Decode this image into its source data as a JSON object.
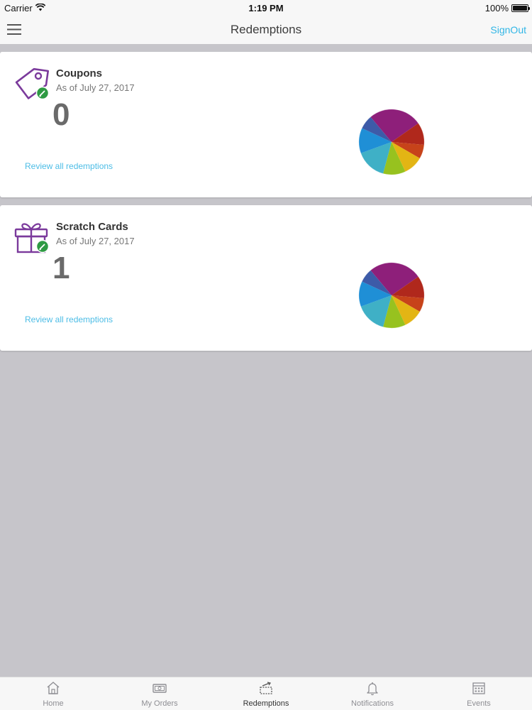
{
  "status_bar": {
    "carrier": "Carrier",
    "time": "1:19 PM",
    "battery": "100%",
    "battery_level": 1.0
  },
  "nav": {
    "title": "Redemptions",
    "signout_label": "SignOut"
  },
  "cards": [
    {
      "title": "Coupons",
      "date": "As of July 27, 2017",
      "count": "0",
      "link": "Review all redemptions",
      "icon": "tag-icon"
    },
    {
      "title": "Scratch Cards",
      "date": "As of July 27, 2017",
      "count": "1",
      "link": "Review all redemptions",
      "icon": "gift-icon"
    }
  ],
  "tabs": [
    {
      "label": "Home",
      "icon": "home-icon"
    },
    {
      "label": "My Orders",
      "icon": "orders-icon"
    },
    {
      "label": "Redemptions",
      "icon": "redemptions-icon",
      "active": true
    },
    {
      "label": "Notifications",
      "icon": "bell-icon"
    },
    {
      "label": "Events",
      "icon": "calendar-icon"
    }
  ],
  "colors": {
    "accent": "#31b6e6",
    "icon_purple": "#7b3a9c",
    "badge_green": "#2e9a43",
    "background": "#c6c5ca"
  }
}
